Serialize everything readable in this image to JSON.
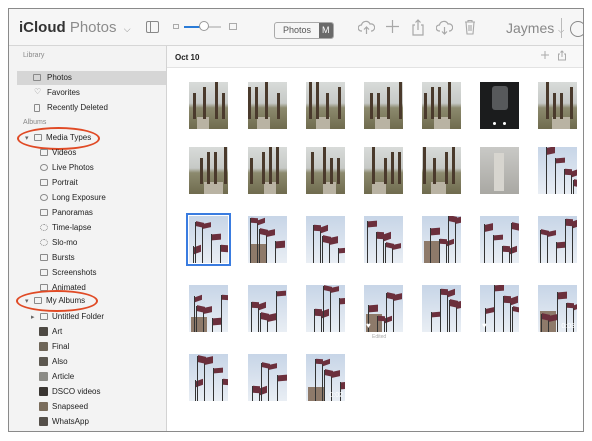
{
  "app": {
    "title_bold": "iCloud",
    "title_light": "Photos",
    "title_chevron": "⌵"
  },
  "toolbar": {
    "segment": [
      "Photos",
      "M"
    ],
    "user_name": "Jaymes",
    "user_chevron": "⌵",
    "icons": [
      "sidebar-toggle-icon",
      "zoom-slider",
      "upload-icon",
      "add-icon",
      "share-icon",
      "download-icon",
      "trash-icon",
      "help-icon"
    ],
    "zoom_level": 0.4
  },
  "sidebar": {
    "library_header": "Library",
    "library": [
      {
        "label": "Photos",
        "icon": "photos-icon",
        "selected": true
      },
      {
        "label": "Favorites",
        "icon": "heart-icon"
      },
      {
        "label": "Recently Deleted",
        "icon": "trash-icon"
      }
    ],
    "albums_header": "Albums",
    "media_types": {
      "label": "Media Types",
      "expanded": true,
      "circled": true
    },
    "media_items": [
      {
        "label": "Videos",
        "icon": "video-icon"
      },
      {
        "label": "Live Photos",
        "icon": "live-photo-icon"
      },
      {
        "label": "Portrait",
        "icon": "portrait-icon"
      },
      {
        "label": "Long Exposure",
        "icon": "long-exposure-icon"
      },
      {
        "label": "Panoramas",
        "icon": "panorama-icon"
      },
      {
        "label": "Time-lapse",
        "icon": "timelapse-icon"
      },
      {
        "label": "Slo-mo",
        "icon": "slomo-icon"
      },
      {
        "label": "Bursts",
        "icon": "bursts-icon"
      },
      {
        "label": "Screenshots",
        "icon": "screenshot-icon"
      },
      {
        "label": "Animated",
        "icon": "animated-icon"
      }
    ],
    "my_albums": {
      "label": "My Albums",
      "expanded": true,
      "circled": true
    },
    "album_items": [
      {
        "label": "Untitled Folder",
        "icon": "folder-icon",
        "collapsed": true
      },
      {
        "label": "Art",
        "icon": "album-thumbnail"
      },
      {
        "label": "Final",
        "icon": "album-thumbnail"
      },
      {
        "label": "Also",
        "icon": "album-thumbnail"
      },
      {
        "label": "Article",
        "icon": "album-thumbnail"
      },
      {
        "label": "DSCO videos",
        "icon": "album-thumbnail"
      },
      {
        "label": "Snapseed",
        "icon": "album-thumbnail"
      },
      {
        "label": "WhatsApp",
        "icon": "album-thumbnail"
      }
    ]
  },
  "main": {
    "date": "Oct 10",
    "date_icons": [
      "add-icon",
      "share-icon"
    ],
    "rows": [
      [
        {
          "kind": "park"
        },
        {
          "kind": "park"
        },
        {
          "kind": "park"
        },
        {
          "kind": "park"
        },
        {
          "kind": "park"
        },
        {
          "kind": "dark"
        },
        {
          "kind": "park"
        }
      ],
      [
        {
          "kind": "park"
        },
        {
          "kind": "park"
        },
        {
          "kind": "park"
        },
        {
          "kind": "park"
        },
        {
          "kind": "park"
        },
        {
          "kind": "gray"
        },
        {
          "kind": "flags"
        }
      ],
      [
        {
          "kind": "flags",
          "selected": true
        },
        {
          "kind": "flags"
        },
        {
          "kind": "flags"
        },
        {
          "kind": "flags"
        },
        {
          "kind": "flags"
        },
        {
          "kind": "flags"
        },
        {
          "kind": "flags"
        }
      ],
      [
        {
          "kind": "flags"
        },
        {
          "kind": "flags"
        },
        {
          "kind": "flags"
        },
        {
          "kind": "flags",
          "heart": true,
          "caption": "Edited"
        },
        {
          "kind": "flags"
        },
        {
          "kind": "flags",
          "heart": true
        },
        {
          "kind": "flags",
          "duration": "0:03"
        }
      ],
      [
        {
          "kind": "flags"
        },
        {
          "kind": "flags"
        },
        {
          "kind": "flags",
          "duration": "0:02"
        }
      ]
    ]
  },
  "colors": {
    "accent": "#3a7ce0",
    "annotation": "#e04a25",
    "sidebar_bg": "#f3f3f3",
    "selection": "#d6d6d6",
    "flag": "#6b2f3c"
  }
}
